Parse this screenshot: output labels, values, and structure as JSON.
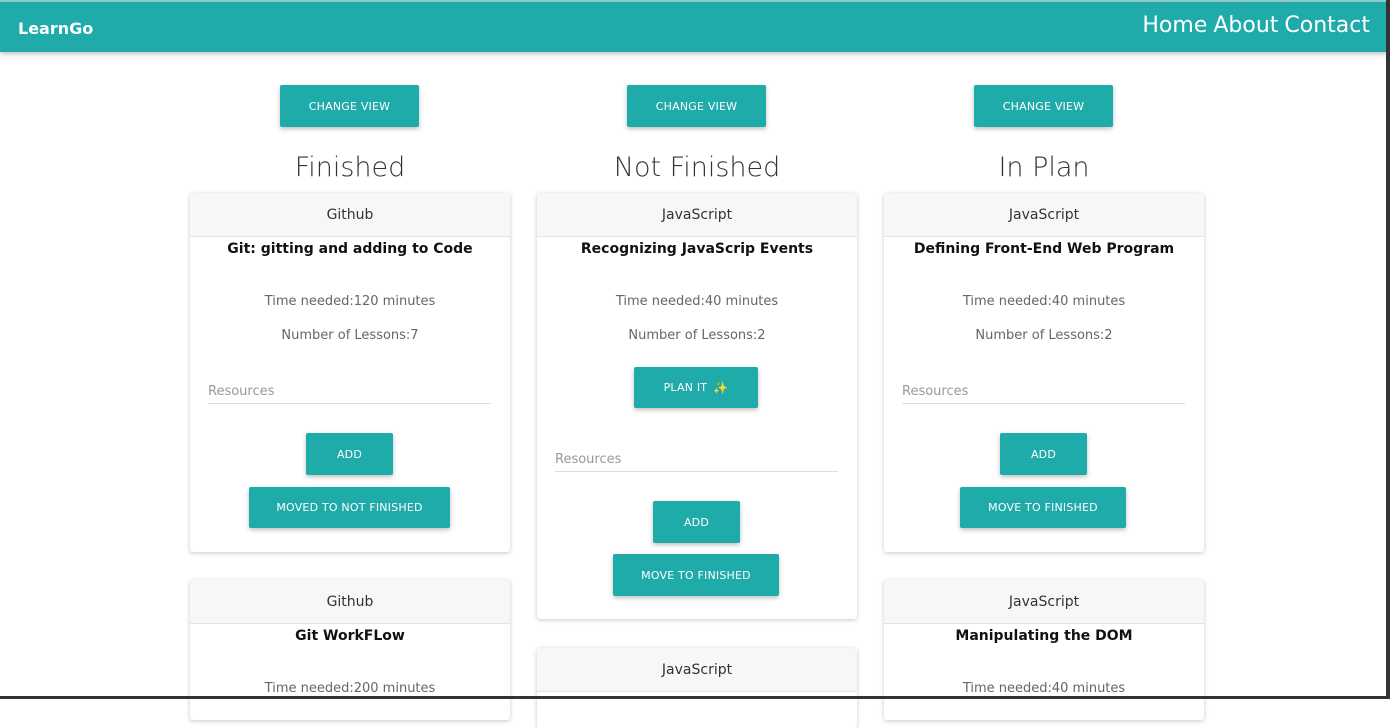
{
  "nav": {
    "brand": "LearnGo",
    "links": [
      "Home",
      "About",
      "Contact"
    ]
  },
  "colors": {
    "accent": "#20abab"
  },
  "columns": [
    {
      "change_view": "CHANGE VIEW",
      "title": "Finished",
      "cards": [
        {
          "category": "Github",
          "title": "Git: gitting and adding to Code",
          "time": "Time needed:120 minutes",
          "lessons": "Number of Lessons:7",
          "resources_placeholder": "Resources",
          "add": "ADD",
          "move": "MOVED TO NOT FINISHED"
        },
        {
          "category": "Github",
          "title": "Git WorkFLow",
          "time": "Time needed:200 minutes"
        }
      ]
    },
    {
      "change_view": "CHANGE VIEW",
      "title": "Not Finished",
      "cards": [
        {
          "category": "JavaScript",
          "title": "Recognizing JavaScrip Events",
          "time": "Time needed:40 minutes",
          "lessons": "Number of Lessons:2",
          "plan": "PLAN IT",
          "resources_placeholder": "Resources",
          "add": "ADD",
          "move": "MOVE TO FINISHED"
        },
        {
          "category": "JavaScript"
        }
      ]
    },
    {
      "change_view": "CHANGE VIEW",
      "title": "In Plan",
      "cards": [
        {
          "category": "JavaScript",
          "title": "Defining Front-End Web Program",
          "time": "Time needed:40 minutes",
          "lessons": "Number of Lessons:2",
          "resources_placeholder": "Resources",
          "add": "ADD",
          "move": "MOVE TO FINISHED"
        },
        {
          "category": "JavaScript",
          "title": "Manipulating the DOM",
          "time": "Time needed:40 minutes"
        }
      ]
    }
  ]
}
